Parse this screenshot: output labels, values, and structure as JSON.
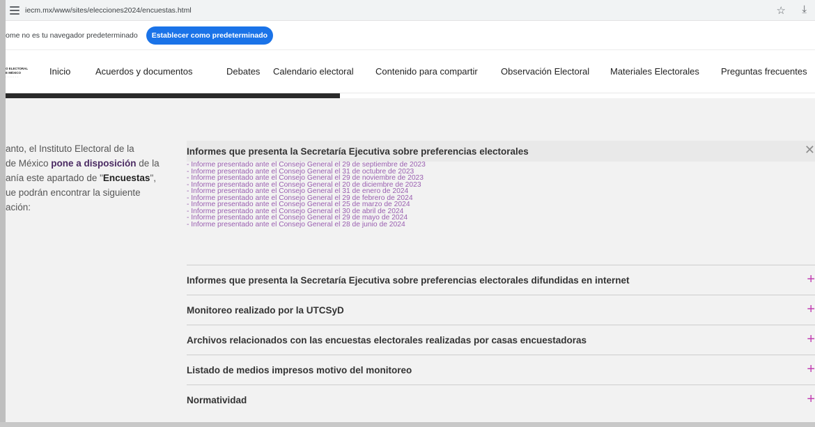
{
  "browser": {
    "url": "iecm.mx/www/sites/elecciones2024/encuestas.html",
    "icons": {
      "site_info": "tune-icon",
      "bookmark": "star-icon",
      "downloads": "download-icon"
    }
  },
  "infobar": {
    "message": "ome no es tu navegador predeterminado",
    "button_label": "Establecer como predeterminado"
  },
  "header": {
    "logo_lines": [
      "O ELECTORAL",
      "E MÉXICO",
      "· · · · · · ·"
    ],
    "nav": [
      "Inicio",
      "Acuerdos y documentos",
      "Debates",
      "Calendario electoral",
      "Contenido para compartir",
      "Observación Electoral",
      "Materiales Electorales",
      "Preguntas frecuentes"
    ]
  },
  "intro": {
    "line1": "anto, el Instituto Electoral de la",
    "line2_pre": " de México ",
    "line2_bold": "pone a disposición",
    "line2_post": " de la",
    "line3_pre": "anía este apartado de \"",
    "line3_bold": "Encuestas",
    "line3_post": "\",",
    "line4": "ue podrán encontrar la siguiente",
    "line5": "ación:"
  },
  "accordion_open": {
    "title": "Informes que presenta la Secretaría Ejecutiva sobre preferencias electorales",
    "links": [
      "- Informe presentado ante el Consejo General el 29 de septiembre de 2023",
      "- Informe presentado ante el Consejo General el 31 de octubre de 2023",
      "- Informe presentado ante el Consejo General el 29 de noviembre de 2023",
      "- Informe presentado ante el Consejo General el 20 de diciembre de 2023",
      "- Informe presentado ante el Consejo General el 31 de enero de 2024",
      "- Informe presentado ante el Consejo General el 29 de febrero de 2024",
      "- Informe presentado ante el Consejo General el 25 de marzo de 2024",
      "- Informe presentado ante el Consejo General el 30 de abril de 2024",
      "- Informe presentado ante el Consejo General el 29 de mayo de 2024",
      "- Informe presentado ante el Consejo General el 28 de junio de 2024"
    ]
  },
  "accordion_items": [
    "Informes que presenta la Secretaría Ejecutiva sobre preferencias electorales difundidas en internet",
    "Monitoreo realizado por la UTCSyD",
    "Archivos relacionados con las encuestas electorales realizadas por casas encuestadoras",
    "Listado de medios impresos motivo del monitoreo",
    "Normatividad"
  ],
  "colors": {
    "chrome_button": "#1a73e8",
    "link_purple": "#9a5fb0",
    "plus_magenta": "#c23fb3",
    "intro_emphasis": "#4a2a62"
  }
}
